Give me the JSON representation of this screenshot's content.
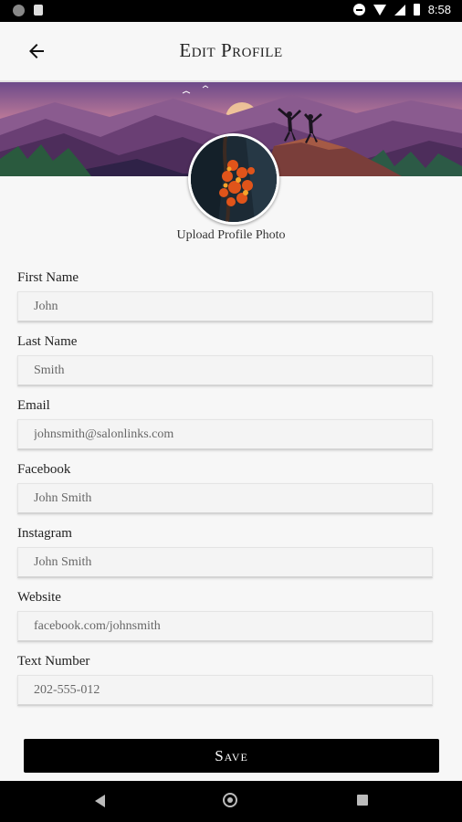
{
  "status_bar": {
    "time": "8:58",
    "icons": [
      "notification-icon",
      "sim-icon",
      "dnd-icon",
      "wifi-icon",
      "signal-icon",
      "battery-icon"
    ]
  },
  "header": {
    "title": "Edit Profile",
    "back_icon": "arrow-left-icon"
  },
  "profile": {
    "upload_label": "Upload Profile Photo"
  },
  "form": {
    "fields": [
      {
        "label": "First Name",
        "value": "John"
      },
      {
        "label": "Last Name",
        "value": "Smith"
      },
      {
        "label": "Email",
        "value": "johnsmith@salonlinks.com"
      },
      {
        "label": "Facebook",
        "value": "John Smith"
      },
      {
        "label": "Instagram",
        "value": "John Smith"
      },
      {
        "label": "Website",
        "value": "facebook.com/johnsmith"
      },
      {
        "label": "Text Number",
        "value": "202-555-012"
      }
    ],
    "save_label": "Save"
  },
  "nav_bar": {
    "icons": [
      "back-triangle-icon",
      "home-circle-icon",
      "recents-square-icon"
    ]
  },
  "colors": {
    "background": "#f7f7f7",
    "button": "#000000",
    "button_text": "#ffffff"
  }
}
